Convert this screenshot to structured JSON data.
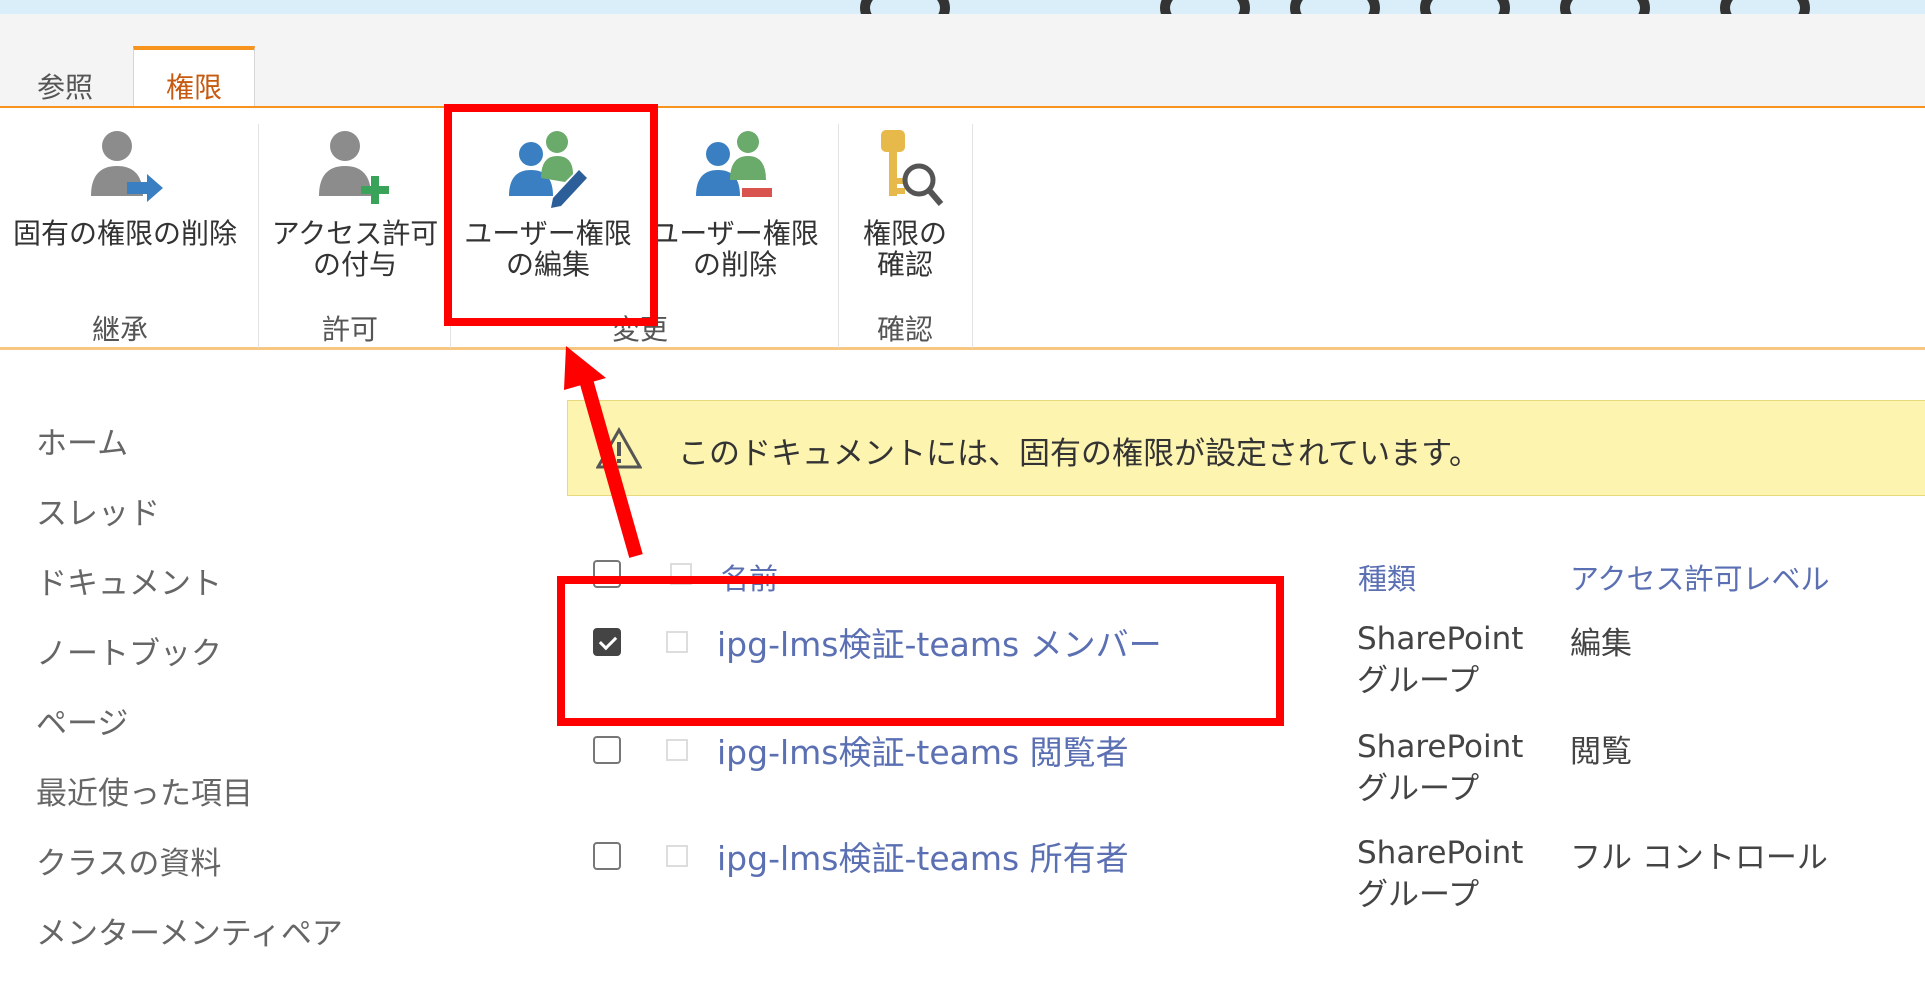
{
  "tabs": [
    {
      "label": "参照"
    },
    {
      "label": "権限"
    }
  ],
  "ribbon": {
    "buttons": [
      {
        "label": "固有の権限の削除"
      },
      {
        "label": "アクセス許可\nの付与"
      },
      {
        "label": "ユーザー権限\nの編集"
      },
      {
        "label": "ユーザー権限\nの削除"
      },
      {
        "label": "権限の\n確認"
      }
    ],
    "groups": [
      "継承",
      "許可",
      "変更",
      "確認"
    ]
  },
  "nav": {
    "items": [
      "ホーム",
      "スレッド",
      "ドキュメント",
      "ノートブック",
      "ページ",
      "最近使った項目",
      "クラスの資料",
      "メンターメンティペア"
    ]
  },
  "notice": {
    "text": "このドキュメントには、固有の権限が設定されています。"
  },
  "table": {
    "columns": {
      "name": "名前",
      "type": "種類",
      "level": "アクセス許可レベル"
    },
    "rows": [
      {
        "name": "ipg-lms検証-teams メンバー",
        "type": "SharePoint\nグループ",
        "level": "編集",
        "checked": true
      },
      {
        "name": "ipg-lms検証-teams 閲覧者",
        "type": "SharePoint\nグループ",
        "level": "閲覧",
        "checked": false
      },
      {
        "name": "ipg-lms検証-teams 所有者",
        "type": "SharePoint\nグループ",
        "level": "フル コントロール",
        "checked": false
      }
    ]
  },
  "colors": {
    "accent": "#f7941d",
    "link": "#5b6fb3",
    "highlight": "#ff0000",
    "notice_bg": "#fdf4b0"
  }
}
